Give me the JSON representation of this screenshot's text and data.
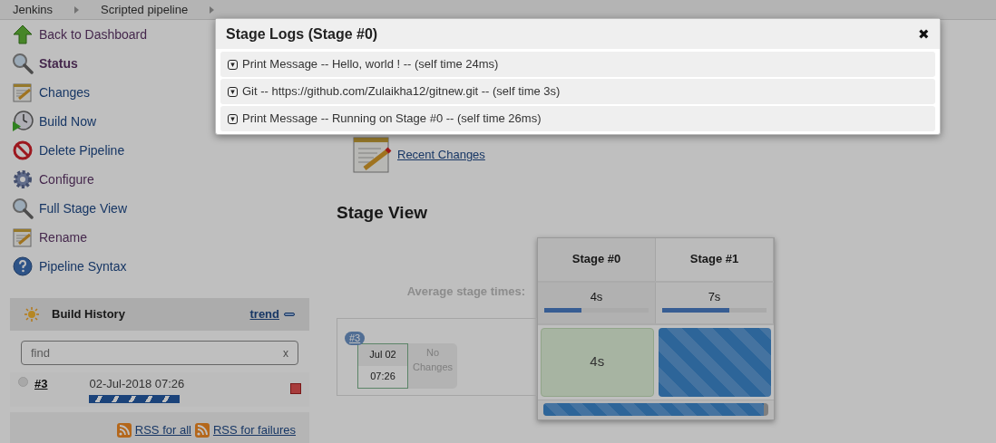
{
  "breadcrumbs": [
    "Jenkins",
    "Scripted pipeline"
  ],
  "sidebar": {
    "items": [
      {
        "label": "Back to Dashboard",
        "visited": true,
        "selected": false
      },
      {
        "label": "Status",
        "visited": true,
        "selected": true
      },
      {
        "label": "Changes",
        "visited": false,
        "selected": false
      },
      {
        "label": "Build Now",
        "visited": false,
        "selected": false
      },
      {
        "label": "Delete Pipeline",
        "visited": false,
        "selected": false
      },
      {
        "label": "Configure",
        "visited": true,
        "selected": false
      },
      {
        "label": "Full Stage View",
        "visited": false,
        "selected": false
      },
      {
        "label": "Rename",
        "visited": true,
        "selected": false
      },
      {
        "label": "Pipeline Syntax",
        "visited": false,
        "selected": false
      }
    ]
  },
  "build_history": {
    "title": "Build History",
    "trend": "trend",
    "search": {
      "placeholder": "find",
      "clear": "x"
    },
    "builds": [
      {
        "number": "#3",
        "time": "02-Jul-2018 07:26",
        "level": 1
      }
    ],
    "rss": [
      "RSS for all",
      "RSS for failures"
    ]
  },
  "recent_changes": "Recent Changes",
  "stage_view": {
    "title": "Stage View",
    "average_label": "Average stage times:",
    "stages": [
      {
        "name": "Stage #0",
        "average": "4s",
        "level": 0.36
      },
      {
        "name": "Stage #1",
        "average": "7s",
        "level": 0.64
      }
    ],
    "builds": [
      {
        "number": "#3",
        "date": "Jul 02",
        "time": "07:26",
        "changes": "No Changes",
        "cells": [
          {
            "kind": "success",
            "text": "4s"
          },
          {
            "kind": "in_progress"
          }
        ],
        "level": 0.98
      }
    ]
  },
  "modal": {
    "title": "Stage Logs (Stage #0)",
    "close": "✖",
    "logs": [
      "Print Message -- Hello, world ! -- (self time 24ms)",
      "Git -- https://github.com/Zulaikha12/gitnew.git -- (self time 3s)",
      "Print Message -- Running on Stage #0 -- (self time 26ms)"
    ],
    "log_icon": "▾"
  }
}
